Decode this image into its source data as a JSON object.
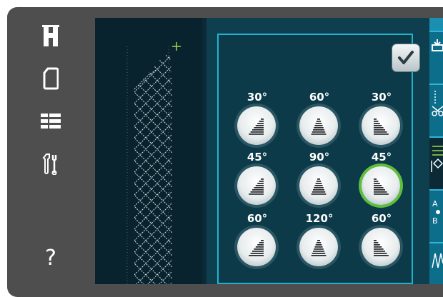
{
  "nav": {
    "items": [
      {
        "name": "home-icon"
      },
      {
        "name": "device-icon"
      },
      {
        "name": "list-icon"
      },
      {
        "name": "tools-icon"
      },
      {
        "name": "help-icon",
        "label": "?"
      }
    ]
  },
  "dialog": {
    "confirm_icon": "checkmark-icon",
    "angles": [
      [
        "30°",
        "60°",
        "30°"
      ],
      [
        "45°",
        "90°",
        "45°"
      ],
      [
        "60°",
        "120°",
        "60°"
      ]
    ],
    "selected_index": 5
  },
  "colors": {
    "frame": "#4e4e4e",
    "screen": "#0b2a36",
    "dialog_border": "#1fb3d1",
    "selected_ring": "#5dbf3a",
    "accent": "#1a8fb1"
  },
  "right_tabs": [
    {
      "icon": "load-icon"
    },
    {
      "icon": "cut-icon"
    },
    {
      "icon": "shape-icon"
    },
    {
      "icon": "ab-icon"
    },
    {
      "icon": "stitch-icon"
    }
  ]
}
